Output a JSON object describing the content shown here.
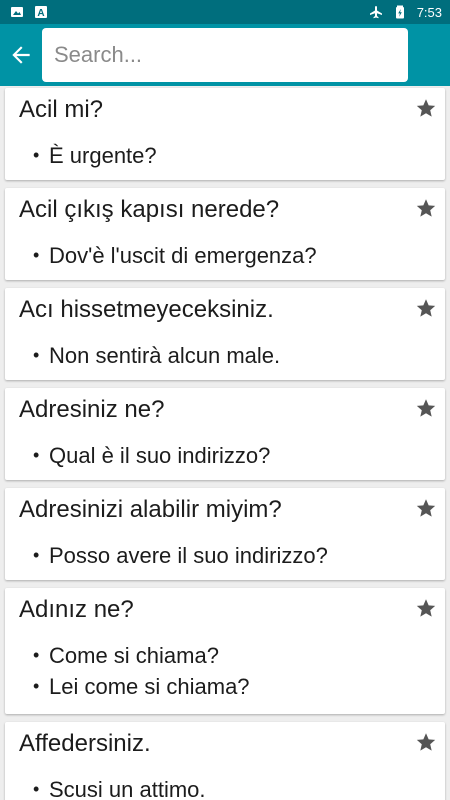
{
  "status_bar": {
    "time": "7:53",
    "left_icons": [
      "image-icon",
      "font-icon"
    ],
    "right_icons": [
      "airplane-icon",
      "battery-icon"
    ]
  },
  "toolbar": {
    "back_icon": "arrow-back-icon",
    "search_placeholder": "Search...",
    "search_value": ""
  },
  "colors": {
    "status_bar": "#006e7d",
    "toolbar": "#0093a5",
    "background": "#eeeeee",
    "star": "#555555"
  },
  "entries": [
    {
      "phrase": "Acil mi?",
      "translations": [
        "È urgente?"
      ],
      "favorite_icon": "star-icon"
    },
    {
      "phrase": "Acil çıkış kapısı nerede?",
      "translations": [
        "Dov'è l'uscit di emergenza?"
      ],
      "favorite_icon": "star-icon"
    },
    {
      "phrase": "Acı hissetmeyeceksiniz.",
      "translations": [
        "Non sentirà alcun male."
      ],
      "favorite_icon": "star-icon"
    },
    {
      "phrase": "Adresiniz ne?",
      "translations": [
        "Qual è il suo indirizzo?"
      ],
      "favorite_icon": "star-icon"
    },
    {
      "phrase": "Adresinizi alabilir miyim?",
      "translations": [
        "Posso avere il suo indirizzo?"
      ],
      "favorite_icon": "star-icon"
    },
    {
      "phrase": "Adınız ne?",
      "translations": [
        "Come si chiama?",
        "Lei come si chiama?"
      ],
      "favorite_icon": "star-icon"
    },
    {
      "phrase": "Affedersiniz.",
      "translations": [
        "Scusi un attimo."
      ],
      "favorite_icon": "star-icon"
    }
  ]
}
